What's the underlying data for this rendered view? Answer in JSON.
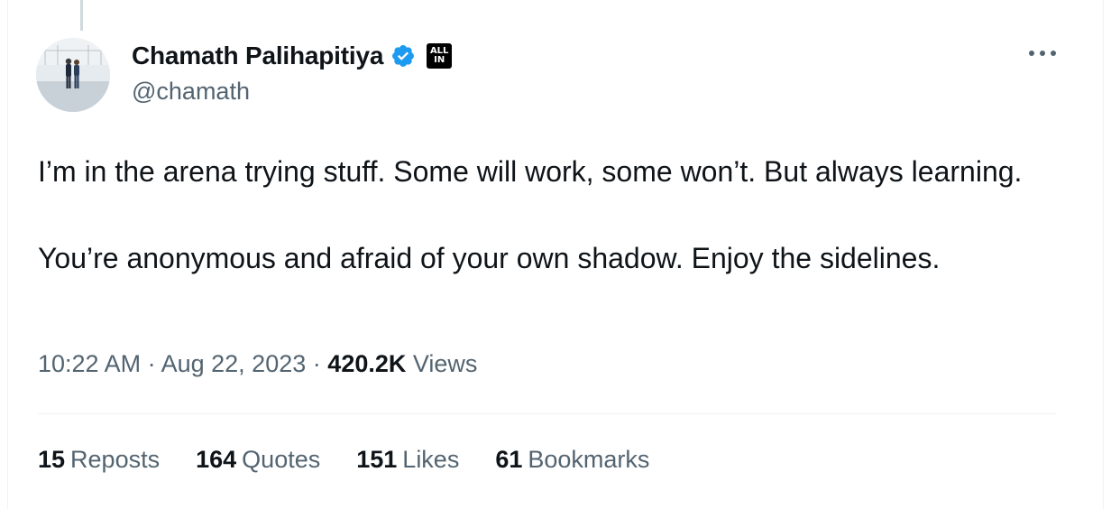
{
  "author": {
    "display_name": "Chamath Palihapitiya",
    "handle": "@chamath",
    "verified": true,
    "affiliation_badge_lines": [
      "ALL",
      "IN"
    ]
  },
  "tweet": {
    "paragraphs": [
      "I’m in the arena trying stuff. Some will work, some won’t. But always learning.",
      "You’re anonymous and afraid of your own shadow. Enjoy the sidelines."
    ],
    "time": "10:22 AM",
    "separator": "·",
    "date": "Aug 22, 2023",
    "views_count": "420.2K",
    "views_label": "Views"
  },
  "stats": [
    {
      "count": "15",
      "label": "Reposts"
    },
    {
      "count": "164",
      "label": "Quotes"
    },
    {
      "count": "151",
      "label": "Likes"
    },
    {
      "count": "61",
      "label": "Bookmarks"
    }
  ],
  "icons": {
    "verified": "verified-badge-icon",
    "more": "more-options-icon"
  },
  "colors": {
    "verified_blue": "#1d9bf0",
    "text_primary": "#0f1419",
    "text_secondary": "#536471",
    "divider": "#eff3f4"
  }
}
